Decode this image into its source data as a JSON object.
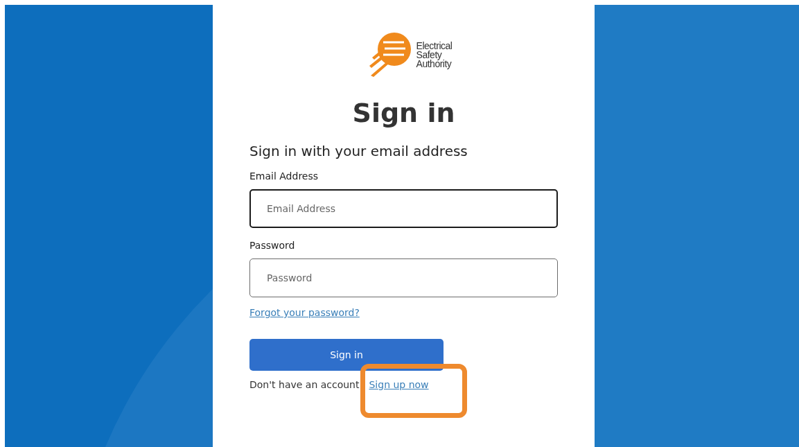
{
  "logo": {
    "lines": [
      "Electrical",
      "Safety",
      "Authority"
    ]
  },
  "title": "Sign in",
  "subtitle": "Sign in with your email address",
  "fields": [
    {
      "label": "Email Address",
      "placeholder": "Email Address",
      "focused": true
    },
    {
      "label": "Password",
      "placeholder": "Password",
      "focused": false
    }
  ],
  "forgot_link": "Forgot your password?",
  "submit_button": "Sign in",
  "signup": {
    "prompt": "Don't have an account",
    "link": "Sign up now",
    "highlighted": true
  }
}
